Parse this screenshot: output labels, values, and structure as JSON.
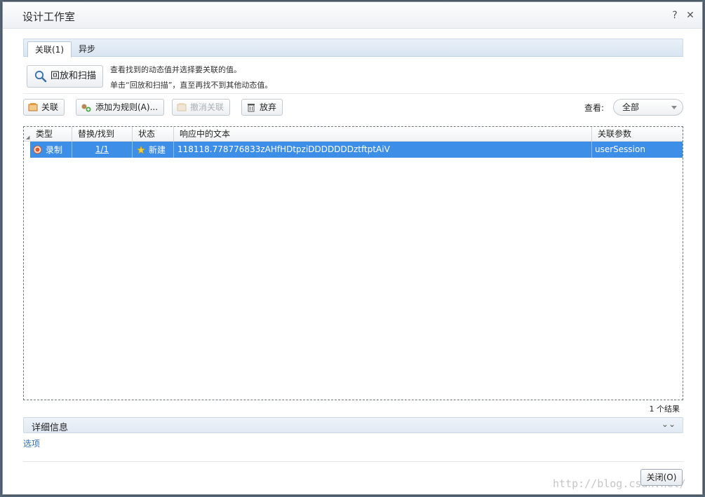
{
  "window": {
    "title": "设计工作室",
    "help_glyph": "?",
    "close_glyph": "✕"
  },
  "tabs": [
    {
      "label": "关联(1)",
      "active": true
    },
    {
      "label": "异步",
      "active": false
    }
  ],
  "scan": {
    "button_label": "回放和扫描",
    "hint_line1": "查看找到的动态值并选择要关联的值。",
    "hint_line2": "单击“回放和扫描”，直至再找不到其他动态值。"
  },
  "toolbar": {
    "correlate_label": "关联",
    "add_rule_label": "添加为规则(A)...",
    "uncorrelate_label": "撤消关联",
    "discard_label": "放弃",
    "view_label": "查看:",
    "view_selected": "全部"
  },
  "grid": {
    "columns": [
      "类型",
      "替换/找到",
      "状态",
      "响应中的文本",
      "关联参数"
    ],
    "rows": [
      {
        "type": "录制",
        "replaced_found": "1/1",
        "status": "新建",
        "text": "118118.778776833zAHfHDtpziDDDDDDDztftptAiV",
        "param": "userSession"
      }
    ]
  },
  "result_count": "1 个结果",
  "details": {
    "label": "详细信息",
    "chevron": "⌄⌄"
  },
  "options_link": "选项",
  "close_button": "关闭(O)",
  "watermark": "http://blog.csdn.net/",
  "colors": {
    "selection": "#3d8ee6",
    "link": "#2d6fb8"
  }
}
